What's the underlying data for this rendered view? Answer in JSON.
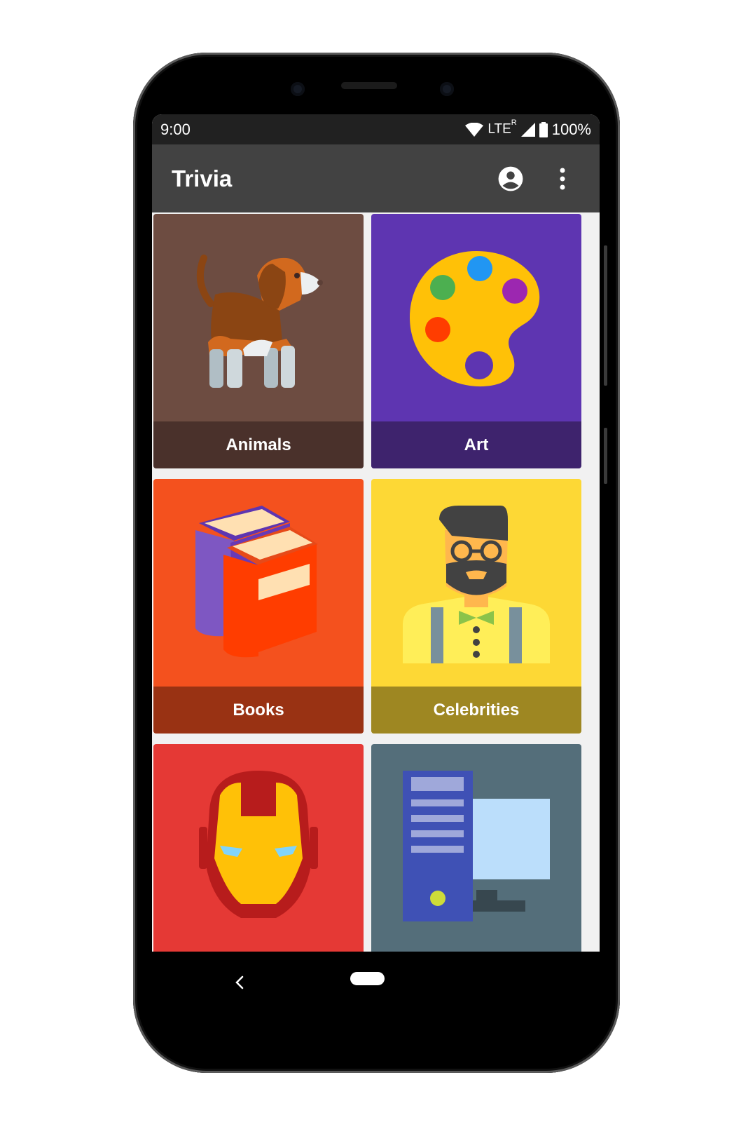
{
  "status_bar": {
    "time": "9:00",
    "network": "LTE",
    "roaming": "R",
    "battery": "100%"
  },
  "app_bar": {
    "title": "Trivia",
    "account_icon": "account-circle-icon",
    "menu_icon": "more-vert-icon"
  },
  "categories": [
    {
      "label": "Animals",
      "icon": "dog-icon",
      "color": "#6d4c41",
      "label_color": "#4a312b"
    },
    {
      "label": "Art",
      "icon": "palette-icon",
      "color": "#5e35b1",
      "label_color": "#3e236d"
    },
    {
      "label": "Books",
      "icon": "books-icon",
      "color": "#f4511e",
      "label_color": "#993213"
    },
    {
      "label": "Celebrities",
      "icon": "celebrity-icon",
      "color": "#fdd835",
      "label_color": "#9e8722"
    },
    {
      "label": "",
      "icon": "superhero-mask-icon",
      "color": "#e53935",
      "label_color": "#902422"
    },
    {
      "label": "",
      "icon": "computer-icon",
      "color": "#546e7a",
      "label_color": "#35454d"
    }
  ],
  "nav_bar": {
    "back_icon": "back-icon",
    "home_icon": "home-pill-icon"
  }
}
